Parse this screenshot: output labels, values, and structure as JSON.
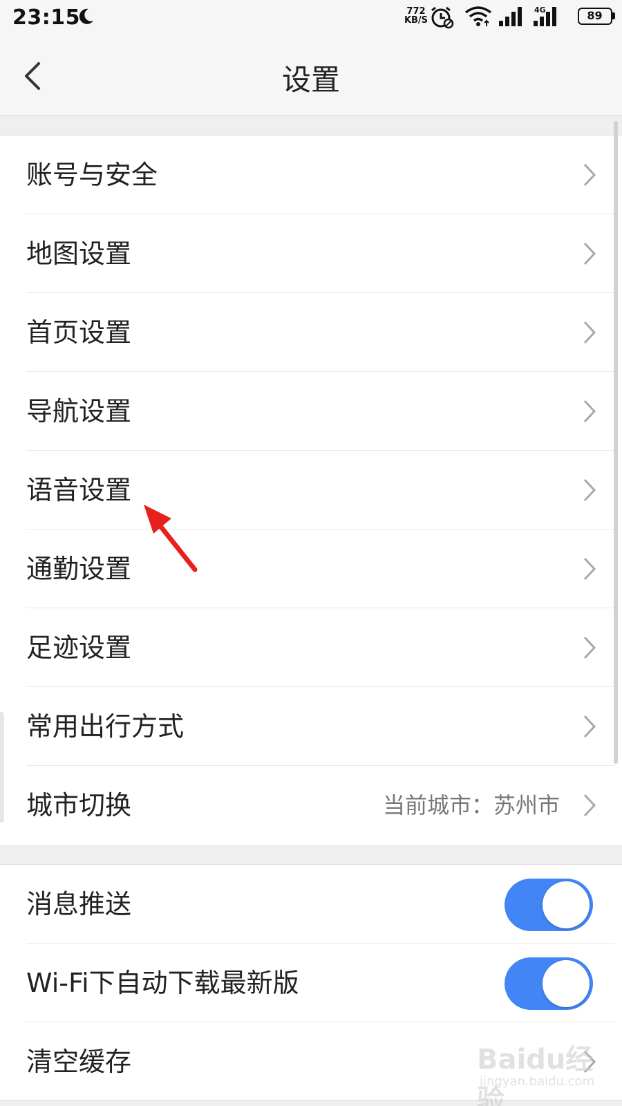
{
  "status_bar": {
    "time": "23:15",
    "net_speed_value": "772",
    "net_speed_unit": "KB/S",
    "network_type": "4G",
    "battery": "89",
    "icons": [
      "moon-icon",
      "alarm-icon",
      "wifi-icon",
      "signal-icon",
      "signal-4g-icon",
      "battery-icon"
    ]
  },
  "header": {
    "title": "设置",
    "back_icon": "chevron-left-icon"
  },
  "settings_group_1": {
    "items": [
      {
        "label": "账号与安全"
      },
      {
        "label": "地图设置"
      },
      {
        "label": "首页设置"
      },
      {
        "label": "导航设置"
      },
      {
        "label": "语音设置"
      },
      {
        "label": "通勤设置"
      },
      {
        "label": "足迹设置"
      },
      {
        "label": "常用出行方式"
      },
      {
        "label": "城市切换",
        "value": "当前城市：苏州市"
      }
    ]
  },
  "settings_group_2": {
    "items": [
      {
        "label": "消息推送",
        "toggle": true
      },
      {
        "label": "Wi-Fi下自动下载最新版",
        "toggle": true
      },
      {
        "label": "清空缓存"
      }
    ]
  },
  "annotation": {
    "arrow_color": "#e8201c",
    "arrow_target": "语音设置"
  },
  "watermark": {
    "logo": "Baidu经验",
    "url": "jingyan.baidu.com"
  },
  "colors": {
    "accent": "#4285f4",
    "background": "#efefef"
  }
}
